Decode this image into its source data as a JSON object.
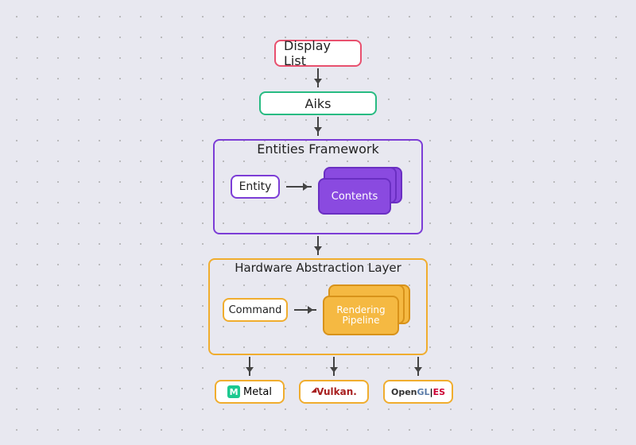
{
  "nodes": {
    "display_list": "Display List",
    "aiks": "Aiks",
    "entities_framework": "Entities Framework",
    "entity": "Entity",
    "contents": "Contents",
    "hal": "Hardware Abstraction Layer",
    "command": "Command",
    "rendering": "Rendering",
    "pipeline": "Pipeline",
    "metal": "Metal",
    "vulkan": "Vulkan",
    "opengl_open": "Open",
    "opengl_gl": "GL",
    "opengl_es": "ES"
  },
  "colors": {
    "bg": "#e8e8f0",
    "red": "#e8506e",
    "green": "#28bb82",
    "purple": "#7c3dd6",
    "purple_fill": "#8a4ae0",
    "yellow": "#f0ad2e",
    "yellow_fill": "#f5b942"
  }
}
